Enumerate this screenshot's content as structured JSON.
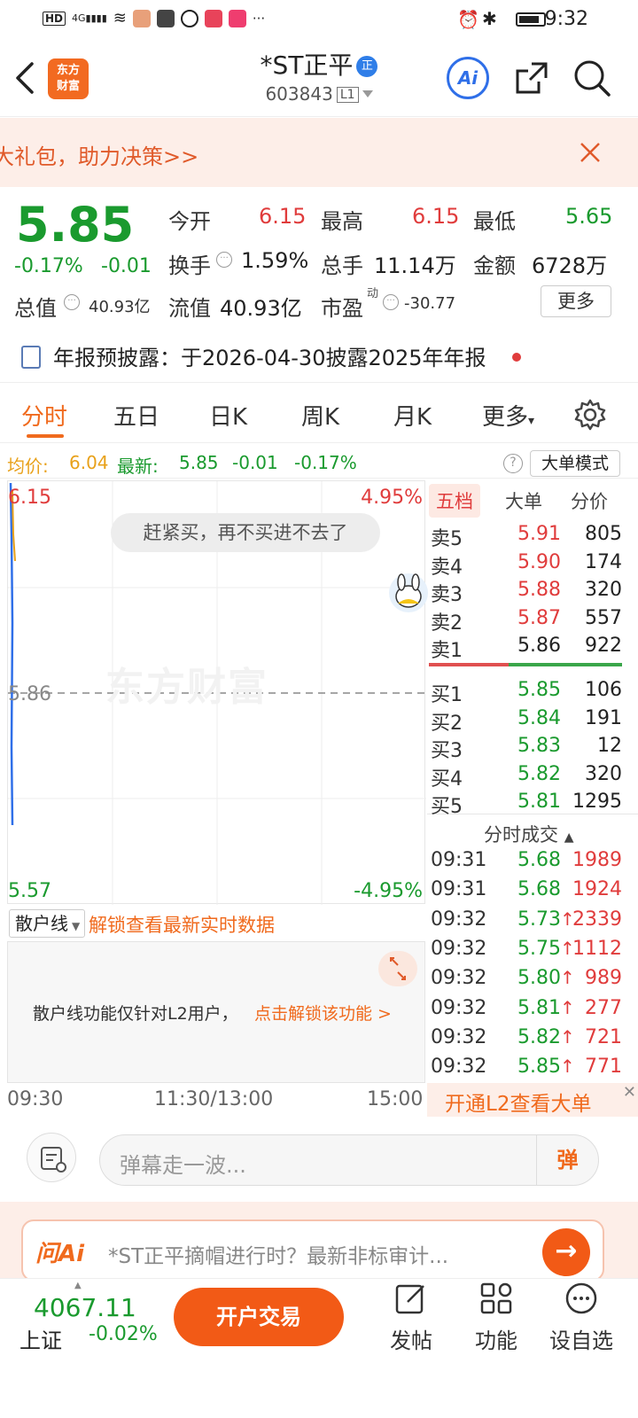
{
  "status": {
    "time": "9:32",
    "dots": "···"
  },
  "header": {
    "logo_line1": "东方",
    "logo_line2": "财富",
    "title": "*ST正平",
    "zheng_badge": "正",
    "code": "603843",
    "level": "L1",
    "ai_label": "Ai"
  },
  "banner": {
    "text": "大礼包，助力决策>>"
  },
  "quote": {
    "price": "5.85",
    "change_pct": "-0.17%",
    "change_val": "-0.01",
    "open_label": "今开",
    "open": "6.15",
    "high_label": "最高",
    "high": "6.15",
    "low_label": "最低",
    "low": "5.65",
    "turnover_label": "换手",
    "turnover": "1.59%",
    "volume_label": "总手",
    "volume": "11.14万",
    "amount_label": "金额",
    "amount": "6728万",
    "mktcap_label": "总值",
    "mktcap": "40.93亿",
    "float_label": "流值",
    "float_cap": "40.93亿",
    "pe_label": "市盈",
    "pe_sup": "动",
    "pe": "-30.77",
    "more_label": "更多"
  },
  "notice": {
    "text": "年报预披露：于2026-04-30披露2025年年报"
  },
  "tabs": [
    "分时",
    "五日",
    "日K",
    "周K",
    "月K",
    "更多"
  ],
  "avg": {
    "avg_label": "均价:",
    "avg_value": "6.04",
    "latest_label": "最新:",
    "latest_value": "5.85",
    "latest_change": "-0.01",
    "latest_pct": "-0.17%",
    "mode_button": "大单模式"
  },
  "chart": {
    "top_price": "6.15",
    "top_pct": "4.95%",
    "mid_price": "5.86",
    "bottom_price": "5.57",
    "bottom_pct": "-4.95%",
    "watermark": "东方财富",
    "toast": "赶紧买，再不买进不去了"
  },
  "book": {
    "tabs": [
      "五档",
      "大单",
      "分价"
    ],
    "asks": [
      {
        "label": "卖5",
        "price": "5.91",
        "vol": "805",
        "color": "#e03c3c"
      },
      {
        "label": "卖4",
        "price": "5.90",
        "vol": "174",
        "color": "#e03c3c"
      },
      {
        "label": "卖3",
        "price": "5.88",
        "vol": "320",
        "color": "#e03c3c"
      },
      {
        "label": "卖2",
        "price": "5.87",
        "vol": "557",
        "color": "#e03c3c"
      },
      {
        "label": "卖1",
        "price": "5.86",
        "vol": "922",
        "color": "#222222"
      }
    ],
    "bids": [
      {
        "label": "买1",
        "price": "5.85",
        "vol": "106"
      },
      {
        "label": "买2",
        "price": "5.84",
        "vol": "191"
      },
      {
        "label": "买3",
        "price": "5.83",
        "vol": "12"
      },
      {
        "label": "买4",
        "price": "5.82",
        "vol": "320"
      },
      {
        "label": "买5",
        "price": "5.81",
        "vol": "1295"
      }
    ],
    "ticks_title": "分时成交",
    "ticks": [
      {
        "time": "09:31",
        "price": "5.68",
        "vol": "1989",
        "arrow": ""
      },
      {
        "time": "09:31",
        "price": "5.68",
        "vol": "1924",
        "arrow": ""
      },
      {
        "time": "09:32",
        "price": "5.73",
        "vol": "2339",
        "arrow": "↑"
      },
      {
        "time": "09:32",
        "price": "5.75",
        "vol": "1112",
        "arrow": "↑"
      },
      {
        "time": "09:32",
        "price": "5.80",
        "vol": "989",
        "arrow": "↑"
      },
      {
        "time": "09:32",
        "price": "5.81",
        "vol": "277",
        "arrow": "↑"
      },
      {
        "time": "09:32",
        "price": "5.82",
        "vol": "721",
        "arrow": "↑"
      },
      {
        "time": "09:32",
        "price": "5.85",
        "vol": "771",
        "arrow": "↑"
      }
    ],
    "l2_promo": "开通L2查看大单"
  },
  "retail": {
    "select_label": "散户线",
    "unlock_text": "解锁查看最新实时数据",
    "info_text": "散户线功能仅针对L2用户，",
    "info_link": "点击解锁该功能 >"
  },
  "time_axis": {
    "start": "09:30",
    "mid": "11:30/13:00",
    "end": "15:00"
  },
  "comment": {
    "placeholder": "弹幕走一波...",
    "dan_label": "弹"
  },
  "ai_bar": {
    "logo": "问Ai",
    "text": "*ST正平摘帽进行时？最新非标审计..."
  },
  "bottom": {
    "index_value": "4067.11",
    "index_name": "上证",
    "index_change": "-0.02%",
    "trade_label": "开户交易",
    "items": [
      "发帖",
      "功能",
      "设自选"
    ]
  }
}
